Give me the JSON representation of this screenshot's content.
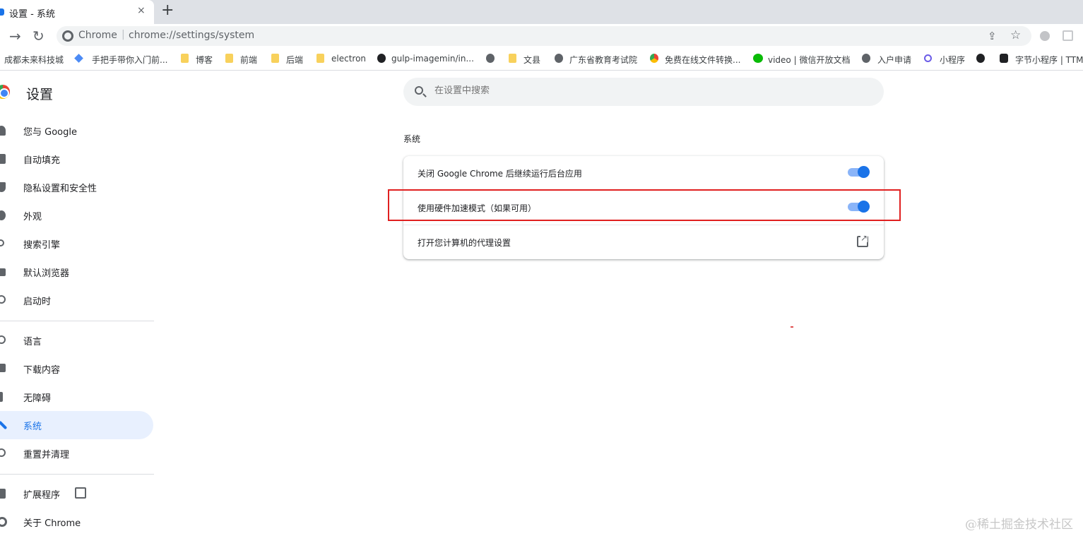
{
  "tab": {
    "title": "设置 - 系统",
    "close": "×",
    "new_tab": "+"
  },
  "toolbar": {
    "back": "→",
    "reload": "↻",
    "omnibox_site": "Chrome",
    "omnibox_sep": "|",
    "omnibox_url": "chrome://settings/system",
    "share": "⇪",
    "star": "☆"
  },
  "bookmarks": [
    "成都未来科技城",
    "手把手带你入门前...",
    "博客",
    "前端",
    "后端",
    "electron",
    "gulp-imagemin/in...",
    "文县",
    "广东省教育考试院",
    "免费在线文件转换...",
    "video | 微信开放文档",
    "入户申请",
    "小程序",
    "字节小程序 | TTM"
  ],
  "sidebar": {
    "title": "设置",
    "items": [
      {
        "label": "您与 Google"
      },
      {
        "label": "自动填充"
      },
      {
        "label": "隐私设置和安全性"
      },
      {
        "label": "外观"
      },
      {
        "label": "搜索引擎"
      },
      {
        "label": "默认浏览器"
      },
      {
        "label": "启动时"
      },
      {
        "label": "语言"
      },
      {
        "label": "下载内容"
      },
      {
        "label": "无障碍"
      },
      {
        "label": "系统"
      },
      {
        "label": "重置并清理"
      },
      {
        "label": "扩展程序"
      },
      {
        "label": "关于 Chrome"
      }
    ],
    "active_item": "系统"
  },
  "search": {
    "placeholder": "在设置中搜索"
  },
  "system": {
    "section_title": "系统",
    "rows": [
      {
        "label": "关闭 Google Chrome 后继续运行后台应用",
        "enabled": true
      },
      {
        "label": "使用硬件加速模式（如果可用）",
        "enabled": true
      },
      {
        "label": "打开您计算机的代理设置"
      }
    ]
  },
  "watermark": "@稀土掘金技术社区",
  "colors": {
    "accent": "#1a73e8",
    "highlight": "#e02020"
  }
}
